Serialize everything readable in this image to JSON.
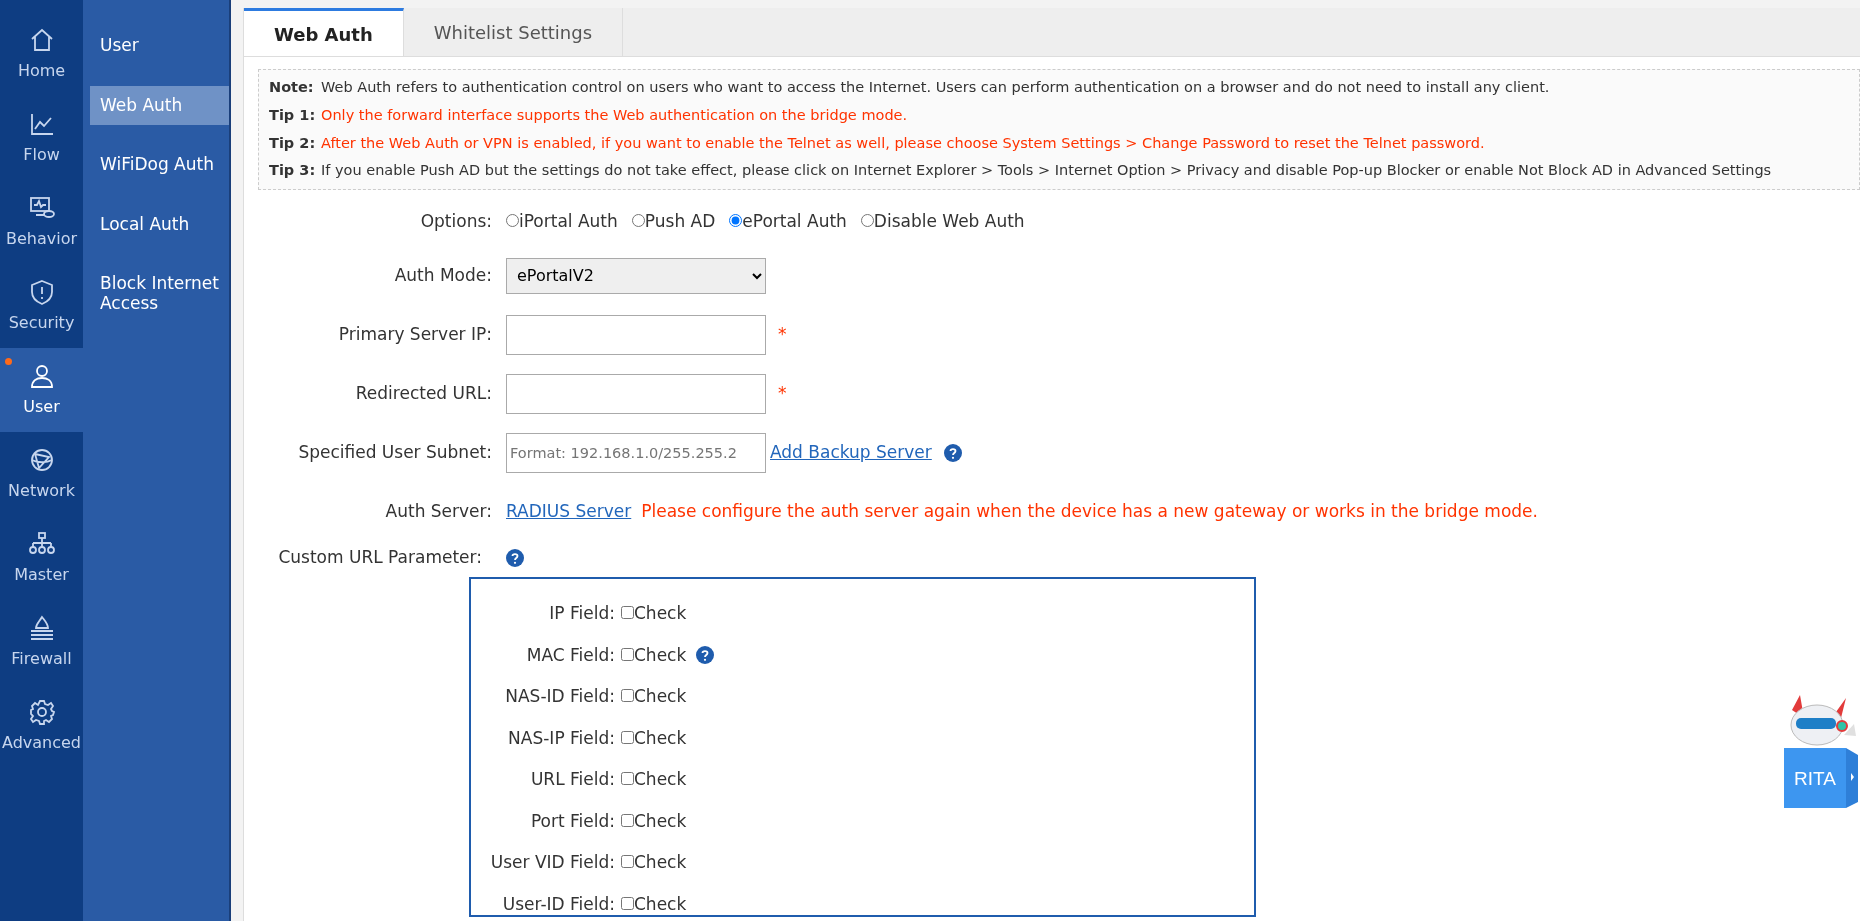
{
  "rail": [
    {
      "label": "Home",
      "selected": false
    },
    {
      "label": "Flow",
      "selected": false
    },
    {
      "label": "Behavior",
      "selected": false
    },
    {
      "label": "Security",
      "selected": false
    },
    {
      "label": "User",
      "selected": true
    },
    {
      "label": "Network",
      "selected": false
    },
    {
      "label": "Master",
      "selected": false
    },
    {
      "label": "Firewall",
      "selected": false
    },
    {
      "label": "Advanced",
      "selected": false
    }
  ],
  "submenu": [
    {
      "label": "User",
      "selected": false
    },
    {
      "label": "Web Auth",
      "selected": true
    },
    {
      "label": "WiFiDog Auth",
      "selected": false
    },
    {
      "label": "Local Auth",
      "selected": false
    },
    {
      "label": "Block Internet Access",
      "selected": false
    }
  ],
  "tabs": [
    {
      "label": "Web Auth",
      "selected": true
    },
    {
      "label": "Whitelist Settings",
      "selected": false
    }
  ],
  "notes": [
    {
      "label": "Note:",
      "text": "Web Auth refers to authentication control on users who want to access the Internet. Users can perform authentication on a browser and do not need to install any client.",
      "warning": false
    },
    {
      "label": "Tip 1:",
      "text": "Only the forward interface supports the Web authentication on the bridge mode.",
      "warning": true
    },
    {
      "label": "Tip 2:",
      "text": "After the Web Auth or VPN is enabled, if you want to enable the Telnet as well, please choose System Settings > Change Password to reset the Telnet password.",
      "warning": true
    },
    {
      "label": "Tip 3:",
      "text": "If you enable Push AD but the settings do not take effect, please click on Internet Explorer > Tools > Internet Option > Privacy and disable Pop-up Blocker or enable Not Block AD in Advanced Settings",
      "warning": false
    }
  ],
  "options": {
    "label": "Options:",
    "choices": [
      {
        "label": "iPortal Auth",
        "selected": false
      },
      {
        "label": "Push AD",
        "selected": false
      },
      {
        "label": "ePortal Auth",
        "selected": true
      },
      {
        "label": "Disable Web Auth",
        "selected": false
      }
    ]
  },
  "auth_mode": {
    "label": "Auth Mode:",
    "value": "ePortalV2"
  },
  "primary_server_ip": {
    "label": "Primary Server IP:",
    "required": "*"
  },
  "redirected_url": {
    "label": "Redirected URL:",
    "required": "*"
  },
  "user_subnet": {
    "label": "Specified User Subnet:",
    "placeholder": "Format: 192.168.1.0/255.255.2",
    "link": "Add Backup Server"
  },
  "auth_server": {
    "label": "Auth Server:",
    "link": "RADIUS Server",
    "warning": "Please configure the auth server again when the device has a new gateway or works in the bridge mode."
  },
  "custom_url": {
    "label": "Custom URL Parameter:",
    "fields": [
      {
        "label": "IP Field:",
        "option": "Check",
        "checked": false,
        "help": false
      },
      {
        "label": "MAC Field:",
        "option": "Check",
        "checked": false,
        "help": true
      },
      {
        "label": "NAS-ID Field:",
        "option": "Check",
        "checked": false,
        "help": false
      },
      {
        "label": "NAS-IP Field:",
        "option": "Check",
        "checked": false,
        "help": false
      },
      {
        "label": "URL Field:",
        "option": "Check",
        "checked": false,
        "help": false
      },
      {
        "label": "Port Field:",
        "option": "Check",
        "checked": false,
        "help": false
      },
      {
        "label": "User VID Field:",
        "option": "Check",
        "checked": false,
        "help": false
      },
      {
        "label": "User-ID Field:",
        "option": "Check",
        "checked": false,
        "help": false
      }
    ]
  },
  "assistant": {
    "label": "RITA"
  }
}
